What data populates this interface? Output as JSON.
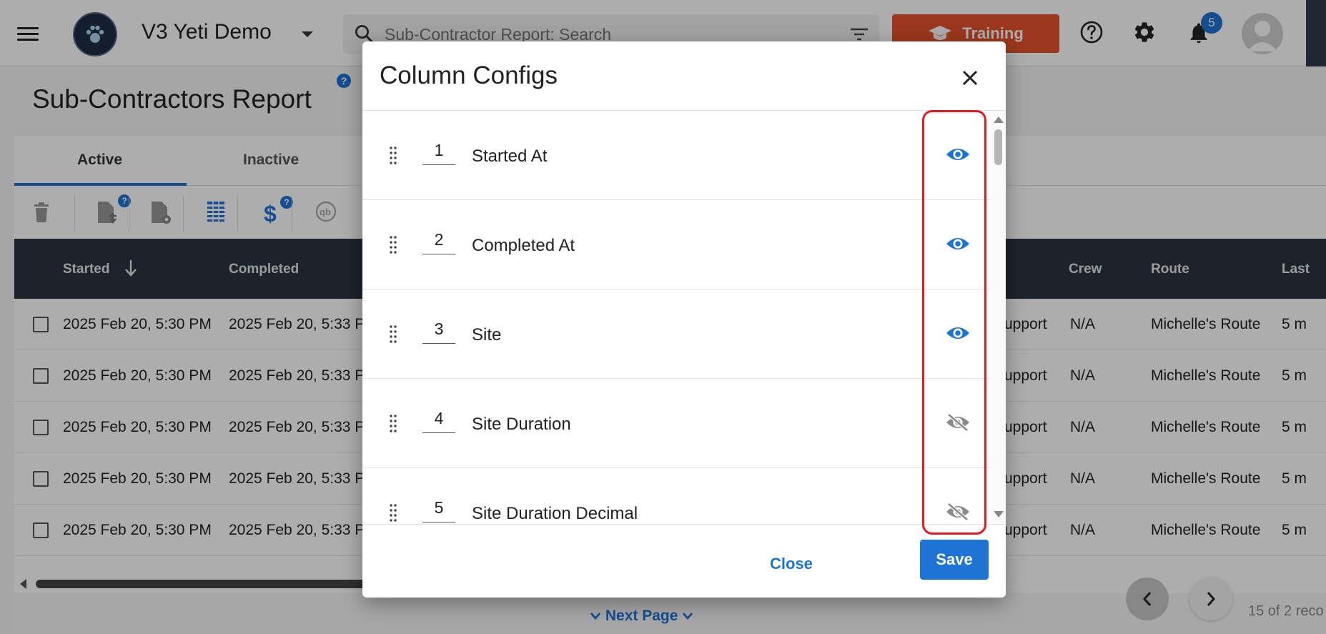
{
  "header": {
    "app_title": "V3 Yeti Demo",
    "search_placeholder": "Sub-Contractor Report: Search",
    "training_label": "Training",
    "notification_count": "5"
  },
  "page": {
    "title": "Sub-Contractors Report",
    "help_mark": "?",
    "tabs": [
      {
        "label": "Active"
      },
      {
        "label": "Inactive"
      }
    ],
    "columns": {
      "started": "Started",
      "completed": "Completed",
      "crew": "Crew",
      "route": "Route",
      "last": "Last"
    },
    "rows": [
      {
        "started": "2025 Feb 20, 5:30 PM",
        "completed": "2025 Feb 20, 5:33 P",
        "service": "upport",
        "crew": "N/A",
        "route": "Michelle's Route",
        "last": "5 m"
      },
      {
        "started": "2025 Feb 20, 5:30 PM",
        "completed": "2025 Feb 20, 5:33 P",
        "service": "upport",
        "crew": "N/A",
        "route": "Michelle's Route",
        "last": "5 m"
      },
      {
        "started": "2025 Feb 20, 5:30 PM",
        "completed": "2025 Feb 20, 5:33 P",
        "service": "upport",
        "crew": "N/A",
        "route": "Michelle's Route",
        "last": "5 m"
      },
      {
        "started": "2025 Feb 20, 5:30 PM",
        "completed": "2025 Feb 20, 5:33 P",
        "service": "upport",
        "crew": "N/A",
        "route": "Michelle's Route",
        "last": "5 m"
      },
      {
        "started": "2025 Feb 20, 5:30 PM",
        "completed": "2025 Feb 20, 5:33 P",
        "service": "upport",
        "crew": "N/A",
        "route": "Michelle's Route",
        "last": "5 m"
      }
    ],
    "next_page": "Next Page",
    "record_count": "15 of 2 reco"
  },
  "modal": {
    "title": "Column Configs",
    "items": [
      {
        "order": "1",
        "label": "Started At",
        "visible": true
      },
      {
        "order": "2",
        "label": "Completed At",
        "visible": true
      },
      {
        "order": "3",
        "label": "Site",
        "visible": true
      },
      {
        "order": "4",
        "label": "Site Duration",
        "visible": false
      },
      {
        "order": "5",
        "label": "Site Duration Decimal",
        "visible": false
      }
    ],
    "close_label": "Close",
    "save_label": "Save"
  },
  "colors": {
    "accent": "#1e73d6",
    "training": "#e5532b",
    "table_header": "#2c3440",
    "highlight": "#e01b24",
    "eye_visible": "#1e73d6",
    "eye_hidden": "#8a8a8a"
  }
}
